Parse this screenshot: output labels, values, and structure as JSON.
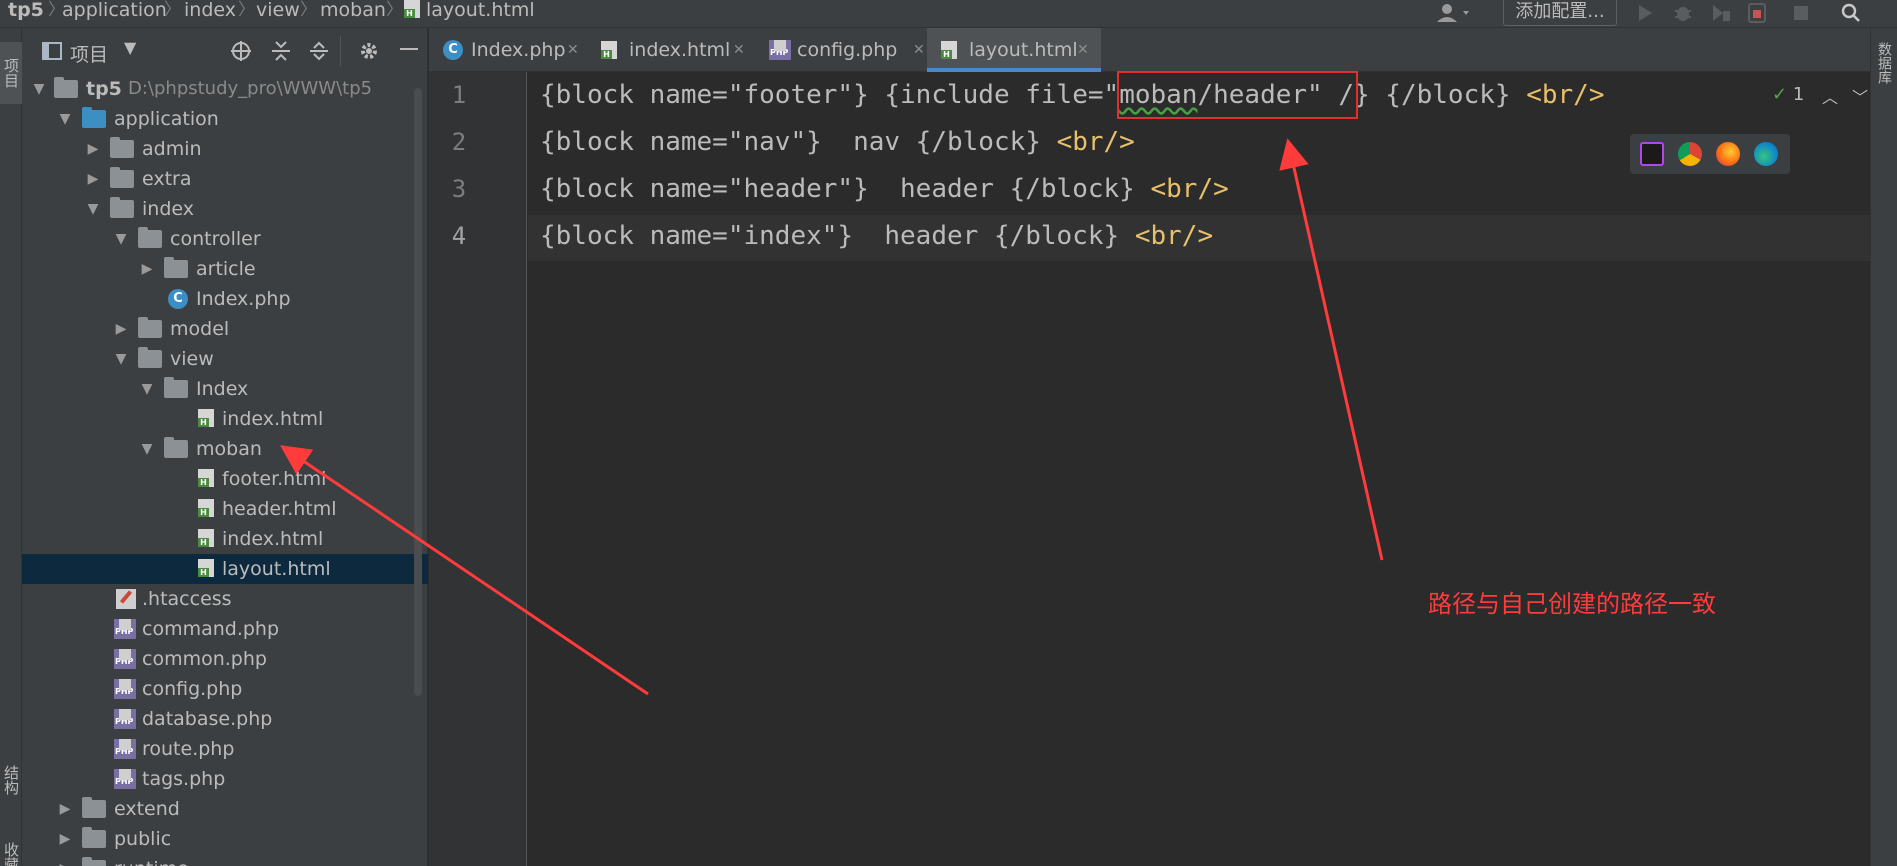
{
  "navbar": {
    "breadcrumbs": [
      "tp5",
      "application",
      "index",
      "view",
      "moban",
      "layout.html"
    ],
    "add_config_label": "添加配置...",
    "icons": [
      "user-icon",
      "run-icon",
      "debug-icon",
      "coverage-icon",
      "profile-icon",
      "stop-icon",
      "search-icon"
    ]
  },
  "left_strip": {
    "project_tab": "项目",
    "structure_tab": "结构",
    "favorites_tab": "收藏夹"
  },
  "project_panel": {
    "title": "项目",
    "tree": [
      {
        "label": "tp5",
        "path": "D:\\phpstudy_pro\\WWW\\tp5",
        "type": "folder"
      },
      {
        "label": "application",
        "type": "folder-blue"
      },
      {
        "label": "admin",
        "type": "folder"
      },
      {
        "label": "extra",
        "type": "folder"
      },
      {
        "label": "index",
        "type": "folder"
      },
      {
        "label": "controller",
        "type": "folder"
      },
      {
        "label": "article",
        "type": "folder"
      },
      {
        "label": "Index.php",
        "type": "class"
      },
      {
        "label": "model",
        "type": "folder"
      },
      {
        "label": "view",
        "type": "folder"
      },
      {
        "label": "Index",
        "type": "folder"
      },
      {
        "label": "index.html",
        "type": "html"
      },
      {
        "label": "moban",
        "type": "folder"
      },
      {
        "label": "footer.html",
        "type": "html"
      },
      {
        "label": "header.html",
        "type": "html"
      },
      {
        "label": "index.html",
        "type": "html"
      },
      {
        "label": "layout.html",
        "type": "html",
        "selected": true
      },
      {
        "label": ".htaccess",
        "type": "htaccess"
      },
      {
        "label": "command.php",
        "type": "php"
      },
      {
        "label": "common.php",
        "type": "php"
      },
      {
        "label": "config.php",
        "type": "php"
      },
      {
        "label": "database.php",
        "type": "php"
      },
      {
        "label": "route.php",
        "type": "php"
      },
      {
        "label": "tags.php",
        "type": "php"
      },
      {
        "label": "extend",
        "type": "folder"
      },
      {
        "label": "public",
        "type": "folder"
      },
      {
        "label": "runtime",
        "type": "folder"
      }
    ]
  },
  "tabs": [
    {
      "label": "Index.php",
      "type": "class"
    },
    {
      "label": "index.html",
      "type": "html"
    },
    {
      "label": "config.php",
      "type": "php"
    },
    {
      "label": "layout.html",
      "type": "html",
      "active": true
    }
  ],
  "editor": {
    "line_numbers": [
      "1",
      "2",
      "3",
      "4"
    ],
    "current_line": 4,
    "lines": [
      {
        "pre": "{block name=\"footer\"} {include file=\"",
        "underlined": "moban",
        "post": "/header\" /} {/block} ",
        "tag": "<br/>"
      },
      {
        "pre": "{block name=\"nav\"}  nav {/block} ",
        "underlined": "",
        "post": "",
        "tag": "<br/>"
      },
      {
        "pre": "{block name=\"header\"}  header {/block} ",
        "underlined": "",
        "post": "",
        "tag": "<br/>"
      },
      {
        "pre": "{block name=\"index\"}  header {/block} ",
        "underlined": "",
        "post": "",
        "tag": "<br/>"
      }
    ],
    "inspection_count": "1",
    "browsers": [
      "phpstorm-icon",
      "chrome-icon",
      "firefox-icon",
      "edge-icon"
    ]
  },
  "right_strip": {
    "database_tab": "数据库"
  },
  "annotation": {
    "text": "路径与自己创建的路径一致",
    "color": "#ff3b3b"
  }
}
